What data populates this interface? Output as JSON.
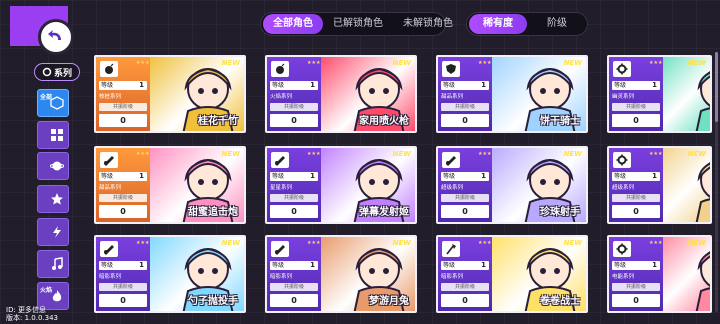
{
  "tabs_roles": [
    {
      "label": "全部角色",
      "active": true
    },
    {
      "label": "已解锁角色",
      "active": false
    },
    {
      "label": "未解锁角色",
      "active": false
    }
  ],
  "tabs_sort": [
    {
      "label": "稀有度",
      "active": true
    },
    {
      "label": "阶级",
      "active": false
    }
  ],
  "sidebar": {
    "series_label": "系列",
    "items": [
      {
        "label": "全部",
        "icon": "cube-icon",
        "active": true
      },
      {
        "label": "",
        "icon": "grid-icon"
      },
      {
        "label": "",
        "icon": "planet-icon"
      },
      {
        "label": "",
        "icon": "star-icon"
      },
      {
        "label": "",
        "icon": "lightning-icon"
      },
      {
        "label": "",
        "icon": "music-icon"
      },
      {
        "label": "火焰",
        "icon": "flame-icon"
      },
      {
        "label": "",
        "icon": "snowflake-icon"
      }
    ]
  },
  "version": {
    "line1": "ID: 更多信息",
    "line2": "版本: 1.0.0.343"
  },
  "card_common": {
    "level_label": "等级",
    "level_value": "1",
    "star_label": "共振阶级",
    "zero": "0",
    "new_tag": "NEW"
  },
  "cards": [
    {
      "name": "桂花千竹",
      "type": "枝桩系列",
      "icon": "bomb-icon",
      "art": "#f0c03a",
      "orange": true
    },
    {
      "name": "家用喷火枪",
      "type": "火焰系列",
      "icon": "bomb-icon",
      "art": "#ff4a6a",
      "orange": false
    },
    {
      "name": "饼干骑士",
      "type": "甜品系列",
      "icon": "shield-icon",
      "art": "#9fd2ff",
      "orange": false
    },
    {
      "name": "",
      "type": "幽灵系列",
      "icon": "gear-icon",
      "art": "#6fe0c0",
      "orange": false
    },
    {
      "name": "甜蜜追击炮",
      "type": "甜品系列",
      "icon": "cannon-icon",
      "art": "#ff8fc0",
      "orange": true
    },
    {
      "name": "弹幕发射姬",
      "type": "星星系列",
      "icon": "cannon-icon",
      "art": "#c080ff",
      "orange": false
    },
    {
      "name": "珍珠射手",
      "type": "超级系列",
      "icon": "cannon-icon",
      "art": "#b8a8ff",
      "orange": false
    },
    {
      "name": "",
      "type": "超级系列",
      "icon": "gear-icon",
      "art": "#f2d28a",
      "orange": false
    },
    {
      "name": "勺子抛投手",
      "type": "暗影系列",
      "icon": "cannon-icon",
      "art": "#7fd8ff",
      "orange": false
    },
    {
      "name": "梦游月兔",
      "type": "暗影系列",
      "icon": "cannon-icon",
      "art": "#e89a6a",
      "orange": false
    },
    {
      "name": "卷卷战士",
      "type": "暗影系列",
      "icon": "axe-icon",
      "art": "#ffe066",
      "orange": false
    },
    {
      "name": "",
      "type": "电能系列",
      "icon": "gear-icon",
      "art": "#ff8aa0",
      "orange": false
    }
  ]
}
